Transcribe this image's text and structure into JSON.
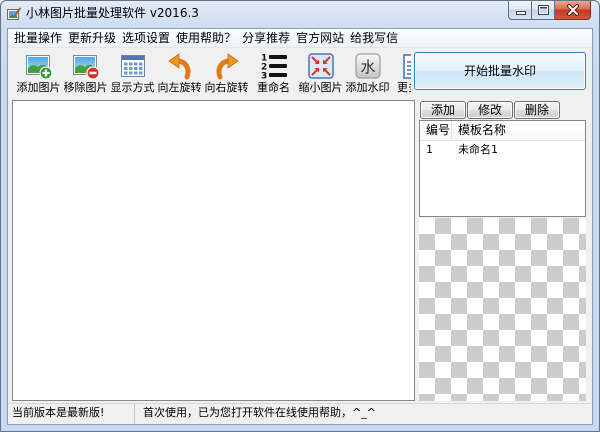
{
  "window": {
    "title": "小林图片批量处理软件 v2016.3",
    "app_icon": "app-icon",
    "controls": [
      "minimize-icon",
      "maximize-icon",
      "close-icon"
    ]
  },
  "menu": [
    "批量操作",
    "更新升级",
    "选项设置",
    "使用帮助？",
    "分享推荐",
    "官方网站",
    "给我写信"
  ],
  "toolbar": {
    "items": [
      {
        "label": "添加图片",
        "icon": "add-image-icon"
      },
      {
        "label": "移除图片",
        "icon": "remove-image-icon"
      },
      {
        "label": "显示方式",
        "icon": "view-mode-icon"
      },
      {
        "label": "向左旋转",
        "icon": "rotate-left-icon"
      },
      {
        "label": "向右旋转",
        "icon": "rotate-right-icon"
      },
      {
        "label": "重命名",
        "icon": "rename-icon",
        "icon_digits": [
          "1",
          "2",
          "3"
        ]
      },
      {
        "label": "缩小图片",
        "icon": "shrink-image-icon"
      },
      {
        "label": "添加水印",
        "icon": "watermark-icon",
        "icon_glyph": "水"
      },
      {
        "label": "更多",
        "icon": "more-icon"
      }
    ]
  },
  "watermark_panel": {
    "start_button_label": "开始批量水印",
    "template_buttons": [
      "添加",
      "修改",
      "删除"
    ],
    "template_list": {
      "columns": [
        "编号",
        "模板名称"
      ],
      "rows": [
        [
          "1",
          "未命名1"
        ]
      ]
    }
  },
  "status_bar": {
    "version_status": "当前版本是最新版!",
    "message": "首次使用，已为您打开软件在线使用帮助，^_^"
  },
  "colors": {
    "window_frame": "#c8d8ee",
    "close_button": "#c4391f",
    "start_button_border": "#3c7fb1",
    "panel_border": "#828790",
    "checker_gray": "#cccccc"
  }
}
